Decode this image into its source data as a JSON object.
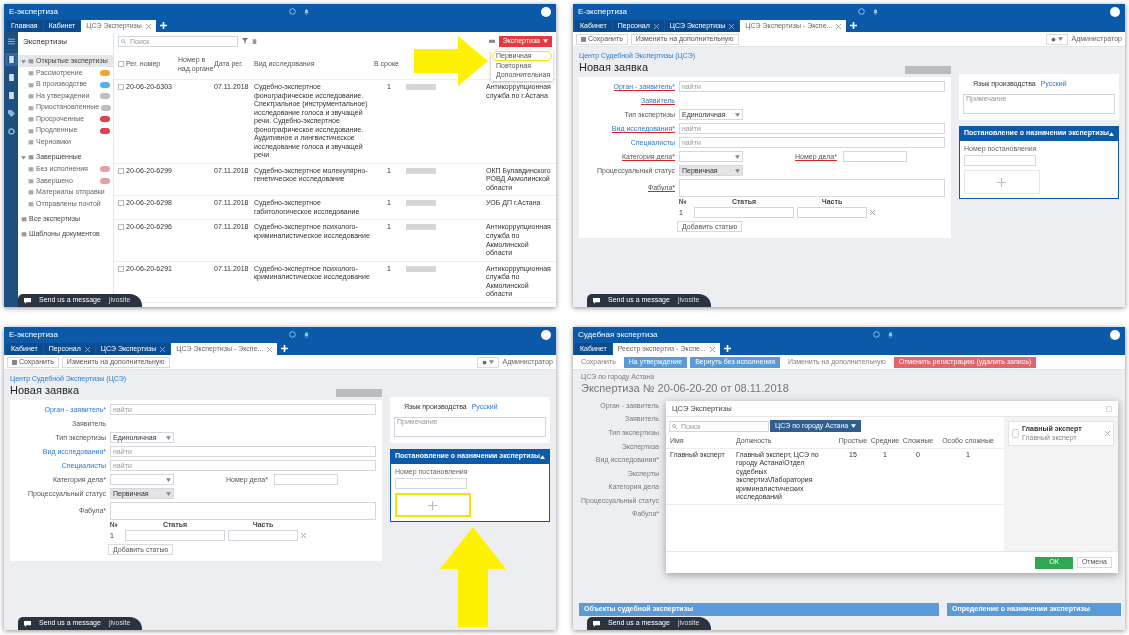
{
  "screens": [
    {
      "kind": "registry",
      "app_title": "E-экспертиза",
      "tabs": [
        {
          "label": "Главная",
          "selected": false,
          "closable": false
        },
        {
          "label": "Кабинет",
          "selected": false,
          "closable": false
        },
        {
          "label": "ЦСЭ Экспертизы",
          "selected": true,
          "closable": true
        }
      ],
      "sidebar": {
        "title": "Экспертизы",
        "groups": [
          {
            "label": "Открытые экспертизы",
            "selected": true,
            "expanded": true,
            "children": [
              {
                "label": "Рассмотрение",
                "color": "#f0a830"
              },
              {
                "label": "В производстве",
                "color": "#5aaee8"
              },
              {
                "label": "На утверждении",
                "color": "#bdbdbd"
              },
              {
                "label": "Приостановленные",
                "color": "#bdbdbd"
              },
              {
                "label": "Просроченные",
                "color": "#e0404e"
              },
              {
                "label": "Продленные",
                "color": "#e0404e"
              },
              {
                "label": "Черновики"
              }
            ]
          },
          {
            "label": "Завершенные",
            "selected": false,
            "expanded": true,
            "children": [
              {
                "label": "Без исполнения",
                "color": "#e8a0a0"
              },
              {
                "label": "Завершено",
                "color": "#e8a0a0"
              },
              {
                "label": "Материалы отправки"
              },
              {
                "label": "Отправлены почтой"
              }
            ]
          },
          {
            "label": "Все экспертизы",
            "selected": false
          },
          {
            "label": "Шаблоны документов",
            "selected": false
          }
        ]
      },
      "search": {
        "placeholder": "Поиск"
      },
      "action": {
        "label": "Экспертиза",
        "menu": [
          {
            "label": "Первичная",
            "highlighted": true
          },
          {
            "label": "Повторная",
            "highlighted": false
          },
          {
            "label": "Дополнительная",
            "highlighted": false
          }
        ]
      },
      "select_all": {
        "checked": false
      },
      "columns": [
        "Рег. номер",
        "Номер в над.органе",
        "Дата рег.",
        "Вид исследования",
        "В сроке"
      ],
      "rows": [
        {
          "checked": false,
          "reg": "20-06-20-6303",
          "date": "07.11.2018",
          "type": "Судебно-экспертное фонографическое исследование. Спектральное (инструментальное) исследование голоса и звучащей речи. Судебно-экспертное фонографическое исследование. Аудитивное и лингвистическое исследование голоса и звучащей речи",
          "count": "1",
          "column_6": "Антикоррупционная служба по г.Астана"
        },
        {
          "checked": false,
          "reg": "20-06-20-6299",
          "date": "07.11.2018",
          "type": "Судебно-экспертное молекулярно-генетическое исследование",
          "count": "1",
          "column_6": "ОКП Булавдинского РОВД Акмолинской области"
        },
        {
          "checked": false,
          "reg": "20-06-20-6298",
          "date": "07.11.2018",
          "type": "Судебно-экспертное габитологическое исследование",
          "count": "1",
          "column_6": "УОБ ДП г.Астана"
        },
        {
          "checked": false,
          "reg": "20-06-20-6296",
          "date": "07.11.2018",
          "type": "Судебно-экспертное психолого-криминалистическое исследование",
          "count": "1",
          "column_6": "Антикоррупционная служба по Акмолинской области"
        },
        {
          "checked": false,
          "reg": "20-06-20-6291",
          "date": "07.11.2018",
          "type": "Судебно-экспертное психолого-криминалистическое исследование",
          "count": "1",
          "column_6": "Антикоррупционная служба по Акмолинской области"
        }
      ],
      "chat": {
        "label": "Send us a message",
        "brand": "jivosite"
      },
      "annotation": {
        "kind": "arrow-right"
      }
    },
    {
      "kind": "form",
      "app_title": "E-экспертиза",
      "tabs": [
        {
          "label": "Кабинет",
          "selected": false,
          "closable": false
        },
        {
          "label": "Персонал",
          "selected": false,
          "closable": true
        },
        {
          "label": "ЦСЭ Экспертизы",
          "selected": false,
          "closable": true
        },
        {
          "label": "ЦСЭ Экспертизы - Экспе...",
          "selected": true,
          "closable": true
        }
      ],
      "toolbar": [
        {
          "label": "Сохранить",
          "kind": "save"
        },
        {
          "label": "Изменить на дополнительную",
          "kind": "plain"
        }
      ],
      "role": "Администратор",
      "breadcrumb": "Центр Судебной Экспертизы (ЦСЭ)",
      "title": "Новая заявка",
      "fields": [
        {
          "kind": "input",
          "label": "Орган - заявитель*",
          "link": true,
          "underlined": true,
          "placeholder": "найти"
        },
        {
          "kind": "static",
          "label": "Заявитель",
          "link": true,
          "underlined": true
        },
        {
          "kind": "select",
          "label": "Тип экспертизы",
          "value": "Единоличная",
          "disabled": false
        },
        {
          "kind": "input",
          "label": "Вид исследования*",
          "link": true,
          "underlined": true,
          "placeholder": "найти"
        },
        {
          "kind": "input",
          "label": "Специалисты",
          "link": true,
          "underlined": false,
          "placeholder": "найти"
        },
        {
          "kind": "pair",
          "label": "Категория дела*",
          "label2": "Номер дела*",
          "underlined": true
        },
        {
          "kind": "select",
          "label": "Процессуальный статус",
          "value": "Первичная",
          "disabled": true
        },
        {
          "kind": "textarea",
          "label": "Фабула*",
          "underlined": true
        }
      ],
      "articles": {
        "columns": [
          "№",
          "Статья",
          "Часть"
        ],
        "rows": [
          {
            "num": "1"
          }
        ],
        "add": "Добавить статью"
      },
      "language": {
        "label": "Язык производства",
        "value": "Русский"
      },
      "note": {
        "placeholder": "Примечание"
      },
      "panel": {
        "title": "Постановление о назначении экспертизы",
        "field": "Номер постановления",
        "highlighted": false
      },
      "chat": {
        "label": "Send us a message",
        "brand": "jivosite"
      }
    },
    {
      "kind": "form",
      "app_title": "E-экспертиза",
      "tabs": [
        {
          "label": "Кабинет",
          "selected": false,
          "closable": false
        },
        {
          "label": "Персонал",
          "selected": false,
          "closable": true
        },
        {
          "label": "ЦСЭ Экспертизы",
          "selected": false,
          "closable": true
        },
        {
          "label": "ЦСЭ Экспертизы - Экспе...",
          "selected": true,
          "closable": true
        }
      ],
      "toolbar": [
        {
          "label": "Сохранить",
          "kind": "save"
        },
        {
          "label": "Изменить на дополнительную",
          "kind": "plain"
        }
      ],
      "role": "Администратор",
      "breadcrumb": "Центр Судебной Экспертизы (ЦСЭ)",
      "title": "Новая заявка",
      "fields": [
        {
          "kind": "input",
          "label": "Орган - заявитель*",
          "link": true,
          "underlined": false,
          "placeholder": "найти"
        },
        {
          "kind": "static",
          "label": "Заявитель",
          "link": false,
          "underlined": false
        },
        {
          "kind": "select",
          "label": "Тип экспертизы",
          "value": "Единоличная",
          "disabled": false
        },
        {
          "kind": "input",
          "label": "Вид исследования*",
          "link": true,
          "underlined": false,
          "placeholder": "найти"
        },
        {
          "kind": "input",
          "label": "Специалисты",
          "link": true,
          "underlined": false,
          "placeholder": "найти"
        },
        {
          "kind": "pair",
          "label": "Категория дела*",
          "label2": "Номер дела*",
          "underlined": false
        },
        {
          "kind": "select",
          "label": "Процессуальный статус",
          "value": "Первичная",
          "disabled": true
        },
        {
          "kind": "textarea",
          "label": "Фабула*",
          "underlined": false
        }
      ],
      "articles": {
        "columns": [
          "№",
          "Статья",
          "Часть"
        ],
        "rows": [
          {
            "num": "1"
          }
        ],
        "add": "Добавить статью"
      },
      "language": {
        "label": "Язык производства",
        "value": "Русский"
      },
      "note": {
        "placeholder": "Примечание"
      },
      "panel": {
        "title": "Постановление о назначении экспертизы",
        "field": "Номер постановления",
        "highlighted": true
      },
      "chat": {
        "label": "Send us a message",
        "brand": "jivosite"
      },
      "annotation": {
        "kind": "arrow-up"
      }
    },
    {
      "kind": "dialog",
      "app_title": "Судебная экспертиза",
      "tabs": [
        {
          "label": "Кабинет",
          "selected": false,
          "closable": false
        },
        {
          "label": "Реестр экспертиз - Экспе...",
          "selected": true,
          "closable": true
        }
      ],
      "toolbar": [
        {
          "label": "Сохранить",
          "kind": "plain"
        },
        {
          "label": "На утверждение",
          "kind": "primary"
        },
        {
          "label": "Вернуть без исполнения",
          "kind": "primary"
        },
        {
          "label": "Изменить на дополнительную",
          "kind": "plain"
        },
        {
          "label": "Отменить регистрацию (удалить запись)",
          "kind": "danger"
        }
      ],
      "breadcrumb": "ЦСЭ по городу Астана",
      "title": "Экспертиза № 20-06-20-20 от 08.11.2018",
      "labels": [
        "Орган - заявитель",
        "Заявитель",
        "Тип экспертизы",
        "Экспертиза",
        "Вид исследования*",
        "Эксперты",
        "Категория дела",
        "Процессуальный статус",
        "Фабула*"
      ],
      "panels": [
        "Объекты судебной экспертизы",
        "Определение о назначении экспертизы"
      ],
      "dialog": {
        "title": "ЦСЭ Экспертизы",
        "search": {
          "placeholder": "Поиск"
        },
        "filter": "ЦСЭ по городу Астана",
        "columns": [
          "Имя",
          "Должность",
          "Простые",
          "Средние",
          "Сложные",
          "Особо сложные"
        ],
        "rows": [
          {
            "cells": [
              "Главный эксперт",
              "Главный эксперт, ЦСЭ по городу Астана\\Отдел судебных экспертиз\\Лаборатория криминалистических исследований",
              "15",
              "1",
              "0",
              "1"
            ]
          }
        ],
        "chosen": [
          {
            "name": "Главный эксперт",
            "subtitle": "Главный эксперт"
          }
        ],
        "ok": "ОК",
        "cancel": "Отмена"
      },
      "chat": {
        "label": "Send us a message",
        "brand": "jivosite"
      }
    }
  ]
}
